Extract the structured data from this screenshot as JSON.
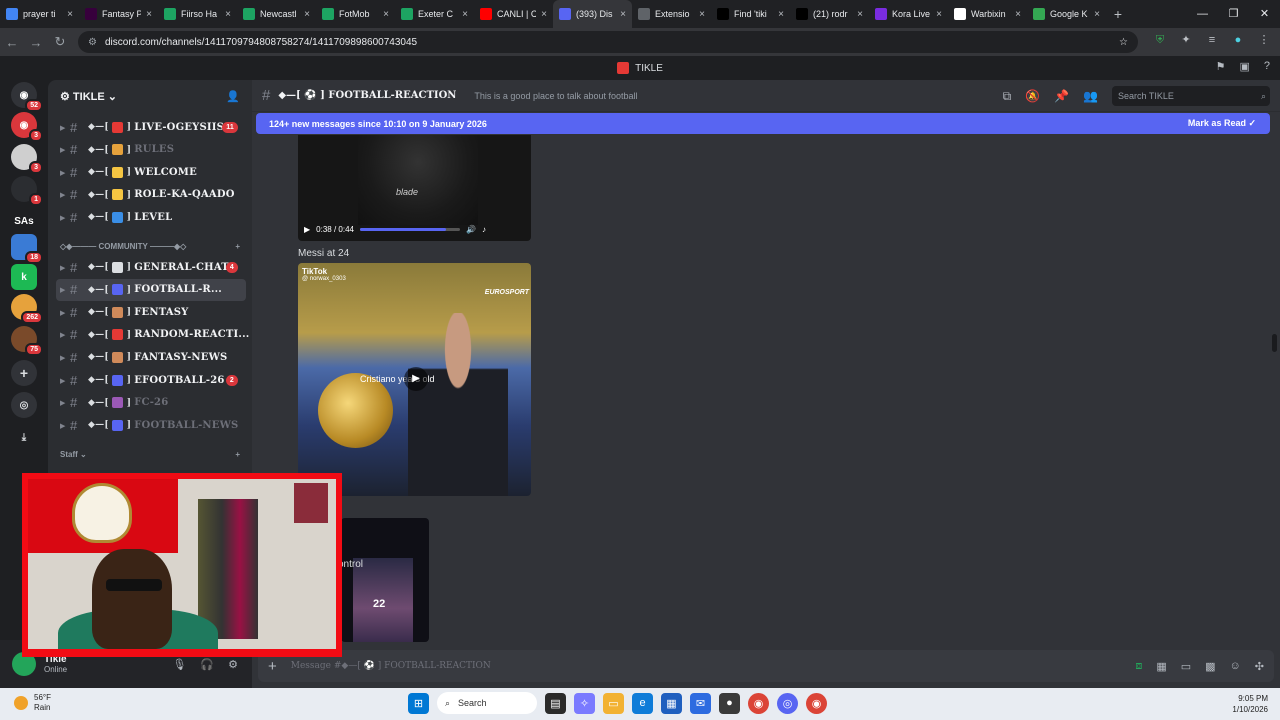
{
  "browser": {
    "tabs": [
      {
        "label": "prayer ti",
        "color": "#4285f4"
      },
      {
        "label": "Fantasy P",
        "color": "#37003c"
      },
      {
        "label": "Fiirso Ha",
        "color": "#1da462"
      },
      {
        "label": "Newcastl",
        "color": "#1da462"
      },
      {
        "label": "FotMob",
        "color": "#1da462"
      },
      {
        "label": "Exeter C",
        "color": "#1da462"
      },
      {
        "label": "CANLI | C",
        "color": "#ff0000"
      },
      {
        "label": "(393) Dis",
        "color": "#5865f2"
      },
      {
        "label": "Extensio",
        "color": "#5f6368"
      },
      {
        "label": "Find 'tiki",
        "color": "#000000"
      },
      {
        "label": "(21) rodr",
        "color": "#000000"
      },
      {
        "label": "Kora Live",
        "color": "#7a2ce0"
      },
      {
        "label": "Warbixin",
        "color": "#ffffff"
      },
      {
        "label": "Google K",
        "color": "#34a853"
      }
    ],
    "active_tab": 7,
    "url": "discord.com/channels/1411709794808758274/1411709898600743045",
    "new_tab": "+",
    "close": "×",
    "window_controls": [
      "—",
      "❐",
      "✕"
    ]
  },
  "discord": {
    "title": "TIKLE",
    "server_name": "TIKLE",
    "guild_badges": [
      "52",
      "3",
      "3",
      "1",
      "18",
      "262",
      "75"
    ],
    "guild_label": "SAs",
    "channels": [
      {
        "name": "LIVE-OGEYSIIS",
        "emoji_color": "#e53935",
        "badge": "11",
        "state": "unread"
      },
      {
        "name": "RULES",
        "emoji_color": "#e6a23c",
        "badge": "",
        "state": "muted"
      },
      {
        "name": "WELCOME",
        "emoji_color": "#f5c542",
        "badge": "",
        "state": "unread"
      },
      {
        "name": "ROLE-KA-QAADO",
        "emoji_color": "#f5c542",
        "badge": "",
        "state": "unread"
      },
      {
        "name": "LEVEL",
        "emoji_color": "#3a8ee6",
        "badge": "",
        "state": "unread"
      }
    ],
    "category_community": "COMMUNITY",
    "community_channels": [
      {
        "name": "GENERAL-CHAT",
        "emoji_color": "#dbdee1",
        "badge": "4",
        "state": "unread"
      },
      {
        "name": "FOOTBALL-R...",
        "emoji_color": "#5865f2",
        "badge": "",
        "state": "active"
      },
      {
        "name": "FENTASY",
        "emoji_color": "#d08a5a",
        "badge": "",
        "state": "unread"
      },
      {
        "name": "RANDOM-REACTI...",
        "emoji_color": "#e53935",
        "badge": "",
        "state": "unread"
      },
      {
        "name": "FANTASY-NEWS",
        "emoji_color": "#d08a5a",
        "badge": "",
        "state": "unread"
      },
      {
        "name": "EFOOTBALL-26",
        "emoji_color": "#5865f2",
        "badge": "2",
        "state": "unread"
      },
      {
        "name": "FC-26",
        "emoji_color": "#9b59b6",
        "badge": "",
        "state": "muted"
      },
      {
        "name": "FOOTBALL-NEWS",
        "emoji_color": "#5865f2",
        "badge": "",
        "state": "muted"
      }
    ],
    "category_staff": "Staff",
    "user": {
      "name": "Tikle",
      "status": "Online"
    },
    "channel_header": {
      "name": "FOOTBALL-REACTION",
      "topic": "This is a good place to talk about football",
      "search_placeholder": "Search TIKLE"
    },
    "new_messages_banner": "124+ new messages since 10:10 on 9 January 2026",
    "mark_as_read": "Mark as Read",
    "video1": {
      "caption": "blade",
      "time": "0:38 / 0:44",
      "progress": 0.86
    },
    "message2_label": "Messi at 24",
    "video2": {
      "caption": "Cristiano      years old",
      "tiktok": "TikTok",
      "handle": "@ norwax_0303",
      "channel_logo": "EUROSPORT"
    },
    "message3_label": "ontrol",
    "video3_number": "22",
    "composer_placeholder": "Message #◆—[ ⚽ ] FOOTBALL-REACTION"
  },
  "taskbar": {
    "weather_temp": "56°F",
    "weather_desc": "Rain",
    "search_label": "Search",
    "time": "9:05 PM",
    "date": "1/10/2026"
  }
}
